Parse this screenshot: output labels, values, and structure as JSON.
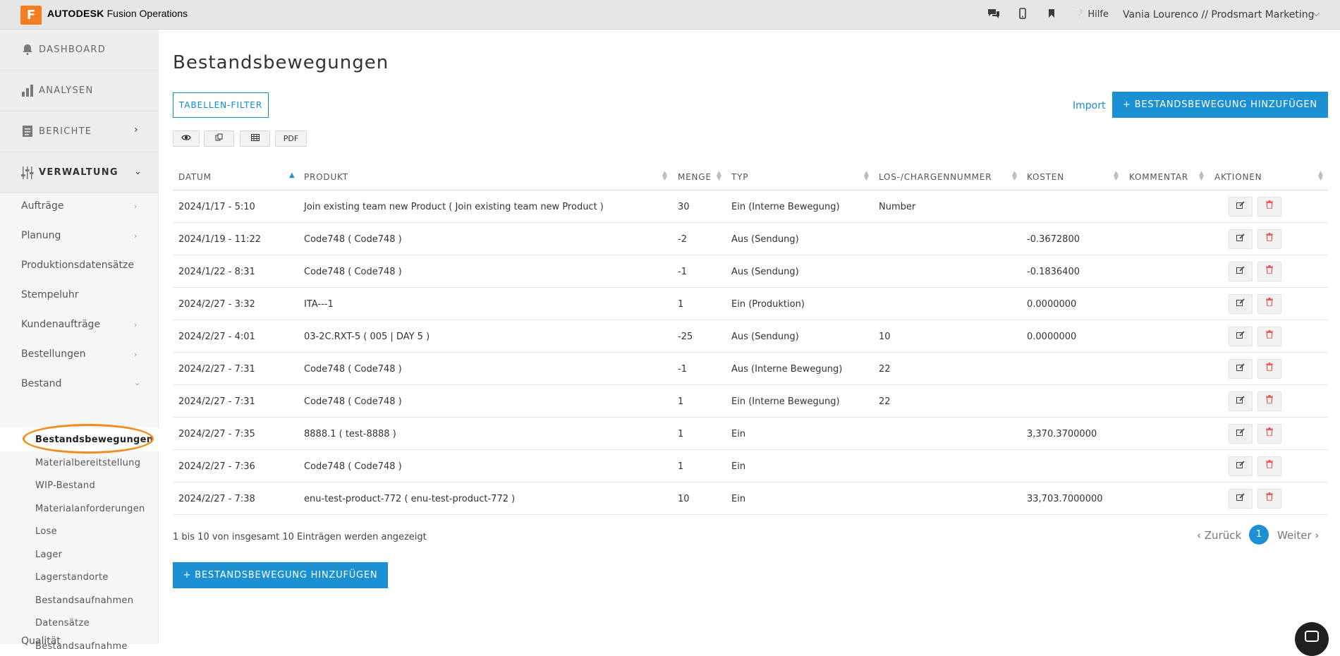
{
  "topbar": {
    "logo_letter": "F",
    "brand_bold": "AUTODESK",
    "brand_rest": " Fusion Operations",
    "help": "Hilfe",
    "user": "Vania Lourenco // Prodsmart Marketing",
    "icons": [
      "chat-icon",
      "mobile-icon",
      "bookmark-icon",
      "help-circle-icon",
      "chevron-down-icon"
    ]
  },
  "sidebar": {
    "top_items": [
      {
        "label": "DASHBOARD",
        "icon": "bell-icon"
      },
      {
        "label": "ANALYSEN",
        "icon": "bar-chart-icon"
      },
      {
        "label": "BERICHTE",
        "icon": "report-icon"
      },
      {
        "label": "VERWALTUNG",
        "icon": "sliders-icon"
      }
    ],
    "items": [
      "Aufträge",
      "Planung",
      "Produktionsdatensätze",
      "Stempeluhr",
      "Kundenaufträge",
      "Bestellungen",
      "Bestand"
    ],
    "sub_items": [
      "Bestandsbewegungen",
      "Materialbereitstellung",
      "WIP-Bestand",
      "Materialanforderungen",
      "Lose",
      "Lager",
      "Lagerstandorte",
      "Bestandsaufnahmen",
      "Datensätze",
      "Bestandsaufnahme"
    ],
    "bottom_item": "Qualität"
  },
  "main": {
    "title": "Bestandsbewegungen",
    "filter_btn": "TABELLEN-FILTER",
    "import_link": "Import",
    "add_btn": "+ BESTANDSBEWEGUNG HINZUFÜGEN",
    "tools": {
      "pdf": "PDF"
    },
    "columns": [
      "DATUM",
      "PRODUKT",
      "MENGE",
      "TYP",
      "LOS-/CHARGENNUMMER",
      "KOSTEN",
      "KOMMENTAR",
      "AKTIONEN"
    ],
    "rows": [
      {
        "datum": "2024/1/17 -  5:10",
        "produkt": "Join existing team new Product ( Join existing team new Product )",
        "menge": "30",
        "typ": "Ein (Interne Bewegung)",
        "los": "Number",
        "kosten": "",
        "kommentar": ""
      },
      {
        "datum": "2024/1/19 -  11:22",
        "produkt": "Code748 ( Code748 )",
        "menge": "-2",
        "typ": "Aus (Sendung)",
        "los": "",
        "kosten": "-0.3672800",
        "kommentar": ""
      },
      {
        "datum": "2024/1/22 -  8:31",
        "produkt": "Code748 ( Code748 )",
        "menge": "-1",
        "typ": "Aus (Sendung)",
        "los": "",
        "kosten": "-0.1836400",
        "kommentar": ""
      },
      {
        "datum": "2024/2/27 -  3:32",
        "produkt": "ITA---1",
        "menge": "1",
        "typ": "Ein (Produktion)",
        "los": "",
        "kosten": "0.0000000",
        "kommentar": ""
      },
      {
        "datum": "2024/2/27 -  4:01",
        "produkt": "03-2C.RXT-5 ( 005 | DAY 5 )",
        "menge": "-25",
        "typ": "Aus (Sendung)",
        "los": "10",
        "kosten": "0.0000000",
        "kommentar": ""
      },
      {
        "datum": "2024/2/27 -  7:31",
        "produkt": "Code748 ( Code748 )",
        "menge": "-1",
        "typ": "Aus (Interne Bewegung)",
        "los": "22",
        "kosten": "",
        "kommentar": ""
      },
      {
        "datum": "2024/2/27 -  7:31",
        "produkt": "Code748 ( Code748 )",
        "menge": "1",
        "typ": "Ein (Interne Bewegung)",
        "los": "22",
        "kosten": "",
        "kommentar": ""
      },
      {
        "datum": "2024/2/27 -  7:35",
        "produkt": "8888.1 ( test-8888 )",
        "menge": "1",
        "typ": "Ein",
        "los": "",
        "kosten": "3,370.3700000",
        "kommentar": ""
      },
      {
        "datum": "2024/2/27 -  7:36",
        "produkt": "Code748 ( Code748 )",
        "menge": "1",
        "typ": "Ein",
        "los": "",
        "kosten": "",
        "kommentar": ""
      },
      {
        "datum": "2024/2/27 -  7:38",
        "produkt": "enu-test-product-772 ( enu-test-product-772 )",
        "menge": "10",
        "typ": "Ein",
        "los": "",
        "kosten": "33,703.7000000",
        "kommentar": ""
      }
    ],
    "summary": "1 bis 10 von insgesamt 10 Einträgen werden angezeigt",
    "pager": {
      "prev": "‹ Zurück",
      "page": "1",
      "next": "Weiter ›"
    }
  },
  "colors": {
    "accent": "#1b90d3",
    "logo": "#f57e22",
    "highlight": "#f28c1c",
    "delete": "#e05a5a"
  }
}
